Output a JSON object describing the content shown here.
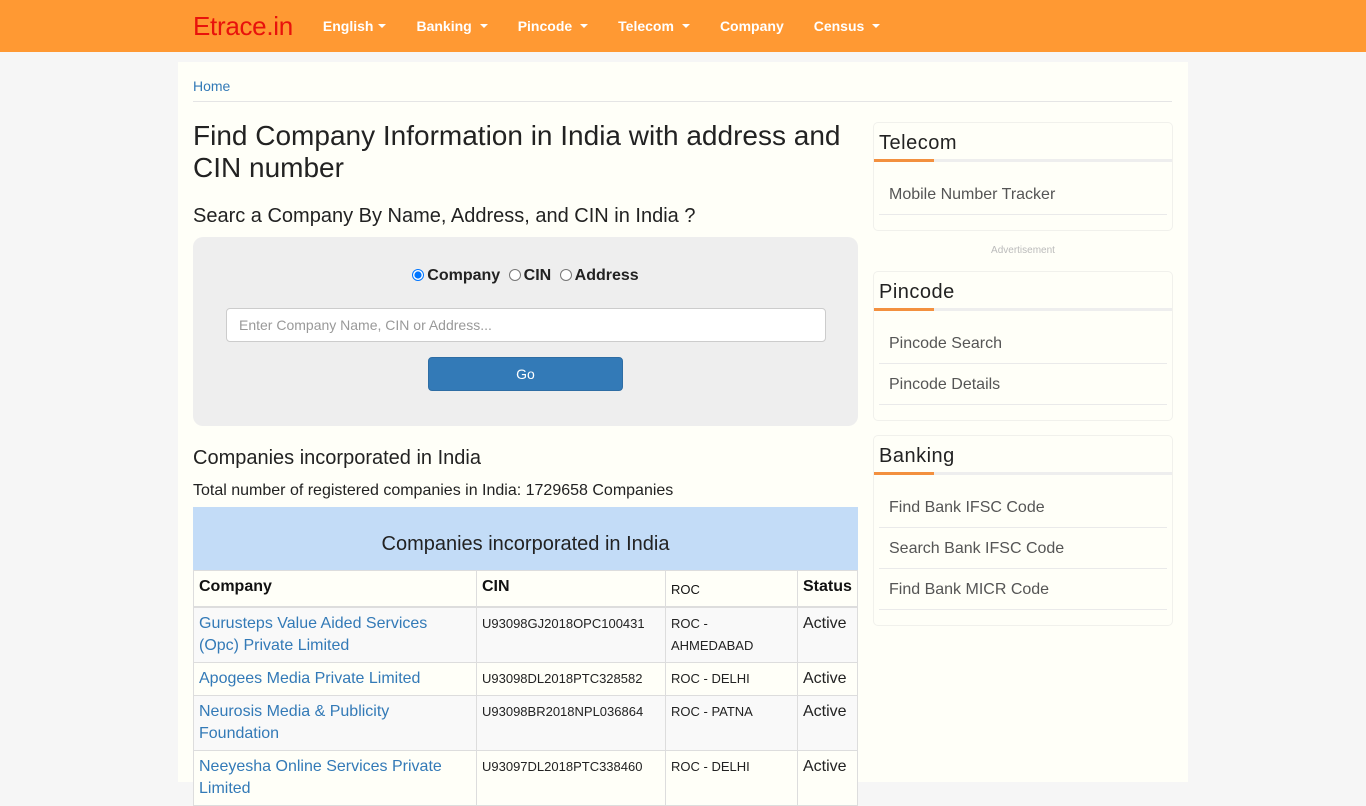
{
  "navbar": {
    "brand": "Etrace.in",
    "items": [
      {
        "label": "English",
        "dropdown": true
      },
      {
        "label": "Banking",
        "dropdown": true
      },
      {
        "label": "Pincode",
        "dropdown": true
      },
      {
        "label": "Telecom",
        "dropdown": true
      },
      {
        "label": "Company",
        "dropdown": false
      },
      {
        "label": "Census",
        "dropdown": true
      }
    ]
  },
  "breadcrumb": {
    "home": "Home"
  },
  "main": {
    "title": "Find Company Information in India with address and CIN number",
    "search_heading": "Searc a Company By Name, Address, and CIN in India ?",
    "search": {
      "options": [
        "Company",
        "CIN",
        "Address"
      ],
      "selected": "Company",
      "placeholder": "Enter Company Name, CIN or Address...",
      "value": "",
      "button_label": "Go"
    },
    "list_heading": "Companies incorporated in India",
    "total_text": "Total number of registered companies in India: 1729658 Companies",
    "table": {
      "caption": "Companies incorporated in India",
      "columns": [
        "Company",
        "CIN",
        "ROC",
        "Status"
      ],
      "rows": [
        {
          "company": "Gurusteps Value Aided Services (Opc) Private Limited",
          "cin": "U93098GJ2018OPC100431",
          "roc": "ROC - AHMEDABAD",
          "status": "Active"
        },
        {
          "company": "Apogees Media Private Limited",
          "cin": "U93098DL2018PTC328582",
          "roc": "ROC - DELHI",
          "status": "Active"
        },
        {
          "company": "Neurosis Media & Publicity Foundation",
          "cin": "U93098BR2018NPL036864",
          "roc": "ROC - PATNA",
          "status": "Active"
        },
        {
          "company": "Neeyesha Online Services Private Limited",
          "cin": "U93097DL2018PTC338460",
          "roc": "ROC - DELHI",
          "status": "Active"
        }
      ]
    }
  },
  "sidebar": {
    "advertisement_label": "Advertisement",
    "widgets": [
      {
        "title": "Telecom",
        "links": [
          "Mobile Number Tracker"
        ]
      },
      {
        "title": "Pincode",
        "links": [
          "Pincode Search",
          "Pincode Details"
        ]
      },
      {
        "title": "Banking",
        "links": [
          "Find Bank IFSC Code",
          "Search Bank IFSC Code",
          "Find Bank MICR Code"
        ]
      }
    ]
  },
  "colors": {
    "navbar": "#ff9933",
    "brand": "#e8120c",
    "link": "#337ab7",
    "button": "#337ab7",
    "caption_bg": "#c3dcf7",
    "widget_accent": "#f3903f"
  }
}
